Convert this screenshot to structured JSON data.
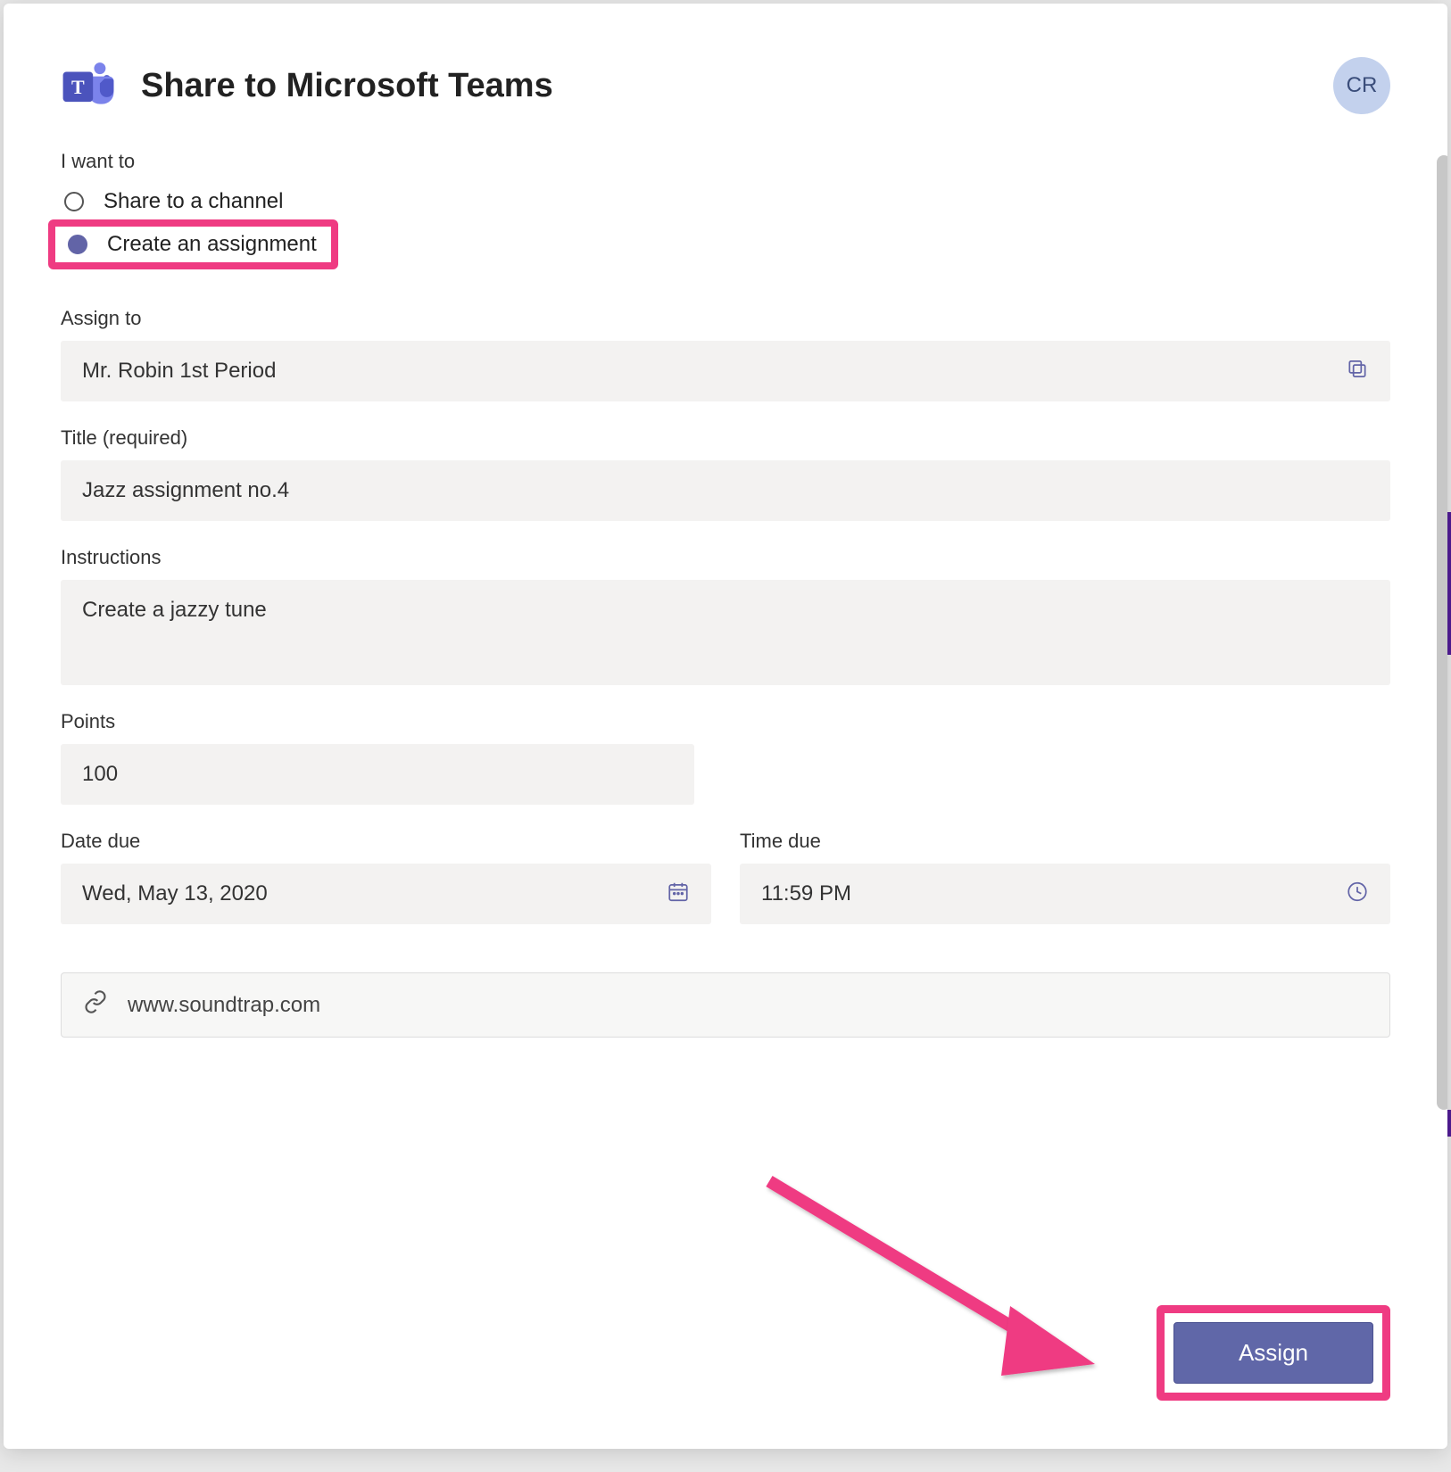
{
  "header": {
    "title": "Share to Microsoft Teams",
    "avatar_initials": "CR"
  },
  "intent": {
    "label": "I want to",
    "options": {
      "share_channel": "Share to a channel",
      "create_assignment": "Create an assignment"
    }
  },
  "assign_to": {
    "label": "Assign to",
    "value": "Mr. Robin 1st Period"
  },
  "title_field": {
    "label": "Title (required)",
    "value": "Jazz assignment no.4"
  },
  "instructions": {
    "label": "Instructions",
    "value": "Create a jazzy tune"
  },
  "points": {
    "label": "Points",
    "value": "100"
  },
  "date_due": {
    "label": "Date due",
    "value": "Wed, May 13, 2020"
  },
  "time_due": {
    "label": "Time due",
    "value": "11:59 PM"
  },
  "link": {
    "url": "www.soundtrap.com"
  },
  "footer": {
    "assign_label": "Assign"
  }
}
